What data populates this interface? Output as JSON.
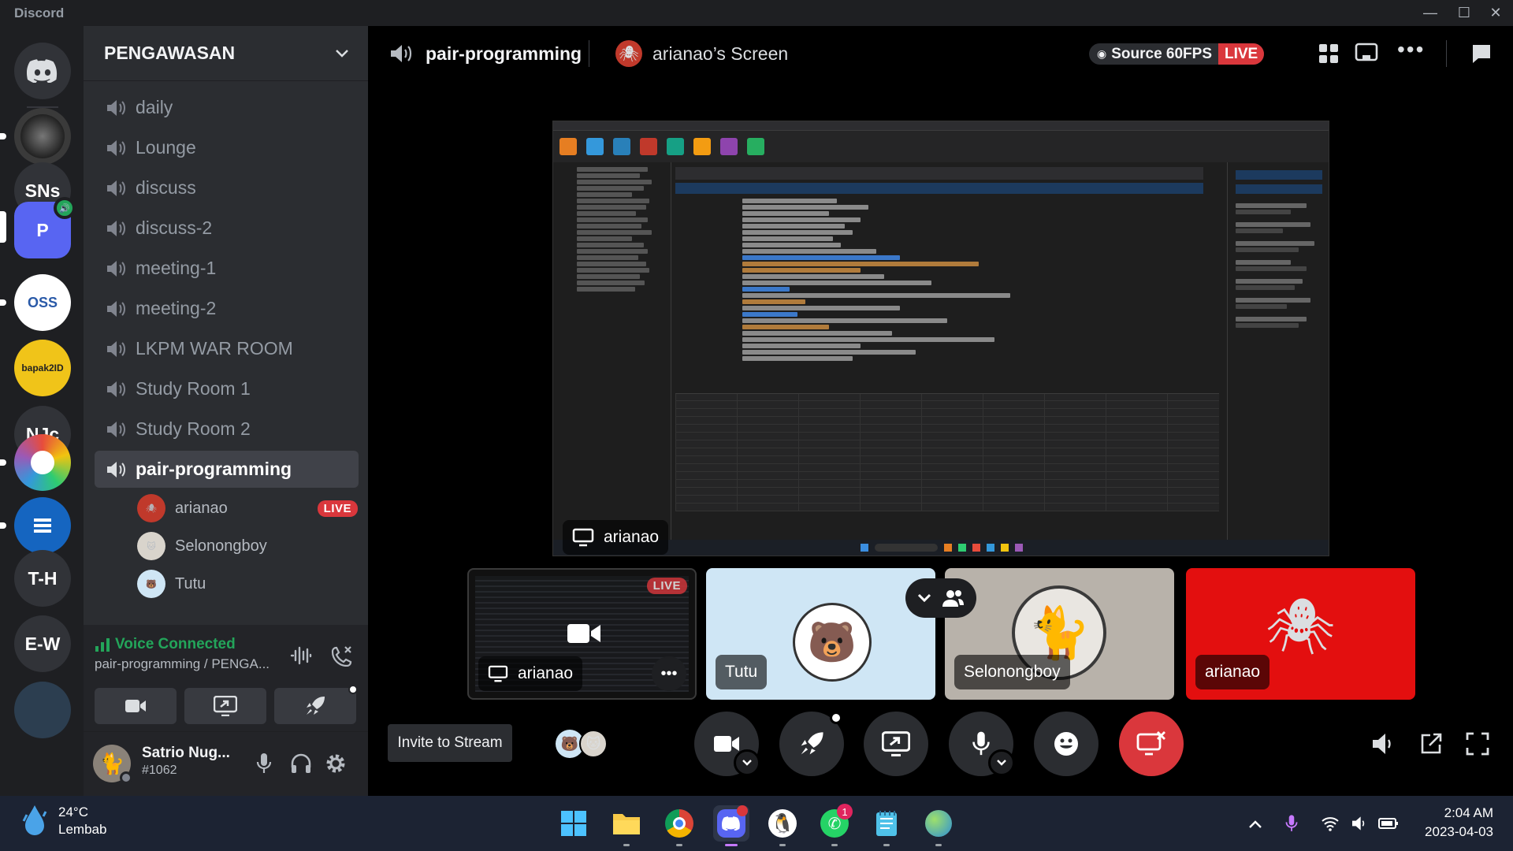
{
  "app": {
    "name": "Discord"
  },
  "servers": [
    {
      "label": "SNs"
    },
    {
      "label": "P"
    },
    {
      "label": "OSS"
    },
    {
      "label": "bapak2ID"
    },
    {
      "label": "NJc"
    },
    {
      "label": "T-H"
    },
    {
      "label": "E-W"
    }
  ],
  "guild": {
    "name": "PENGAWASAN"
  },
  "channels": [
    {
      "label": "daily"
    },
    {
      "label": "Lounge"
    },
    {
      "label": "discuss"
    },
    {
      "label": "discuss-2"
    },
    {
      "label": "meeting-1"
    },
    {
      "label": "meeting-2"
    },
    {
      "label": "LKPM WAR ROOM"
    },
    {
      "label": "Study Room 1"
    },
    {
      "label": "Study Room 2"
    },
    {
      "label": "pair-programming"
    }
  ],
  "voice_users": [
    {
      "name": "arianao",
      "badge": "LIVE"
    },
    {
      "name": "Selonongboy"
    },
    {
      "name": "Tutu"
    }
  ],
  "voice_panel": {
    "status": "Voice Connected",
    "subtitle": "pair-programming / PENGA..."
  },
  "user": {
    "name": "Satrio Nug...",
    "tag": "#1062"
  },
  "topbar": {
    "channel": "pair-programming",
    "screen_title": "arianao’s Screen",
    "source": "Source 60FPS",
    "live": "LIVE"
  },
  "stream": {
    "name": "arianao"
  },
  "tiles": [
    {
      "name": "arianao",
      "badge": "LIVE"
    },
    {
      "name": "Tutu"
    },
    {
      "name": "Selonongboy"
    },
    {
      "name": "arianao"
    }
  ],
  "bottom": {
    "invite_label": "Invite to Stream"
  },
  "taskbar": {
    "weather_temp": "24°C",
    "weather_desc": "Lembab",
    "time": "2:04 AM",
    "date": "2023-04-03",
    "whatsapp_badge": "1"
  },
  "colors": {
    "blurple": "#5865f2",
    "green": "#23a55a",
    "red": "#da373c",
    "bg_dark": "#1e1f22",
    "sidebar": "#2b2d31"
  }
}
